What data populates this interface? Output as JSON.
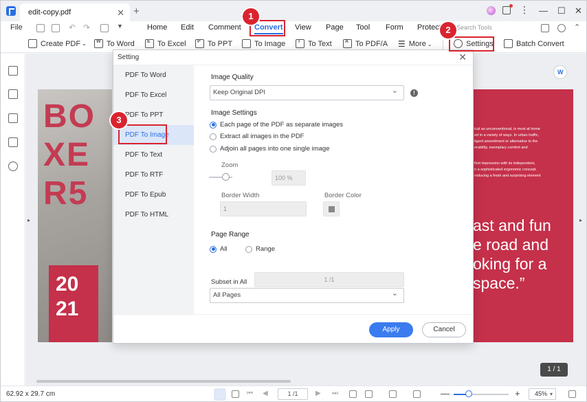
{
  "window": {
    "doc_tab": "edit-copy.pdf",
    "search_placeholder": "Search Tools"
  },
  "menu": {
    "file": "File",
    "items": [
      "Home",
      "Edit",
      "Comment",
      "Convert",
      "View",
      "Page",
      "Tool",
      "Form",
      "Protect"
    ],
    "active": "Convert"
  },
  "ribbon": {
    "create_pdf": "Create PDF",
    "to_word": "To Word",
    "to_excel": "To Excel",
    "to_ppt": "To PPT",
    "to_image": "To Image",
    "to_text": "To Text",
    "to_pdfa": "To PDF/A",
    "more": "More",
    "settings": "Settings",
    "batch_convert": "Batch Convert"
  },
  "document": {
    "left_title": "BOXER5",
    "left_lines": [
      "BO",
      "XE",
      "R5"
    ],
    "year_lines": [
      "20",
      "21"
    ],
    "right_small_1": [
      "ical as unconventional, is most at home",
      "ed in a variety of ways. In urban traffic,",
      "ligent amendment or alternative to the",
      "erability, exemplary comfort and"
    ],
    "right_small_2": [
      "first impression with its independent,",
      "n a sophisticated ergonomic concept.",
      "roducing a fresh and surprising element"
    ],
    "right_quote": [
      "ast and fun",
      "e road and",
      "oking for a",
      "space.”"
    ],
    "page_counter": "1 / 1"
  },
  "statusbar": {
    "dimensions": "62.92 x 29.7 cm",
    "page": "1 /1",
    "zoom": "45%",
    "zoom_level_pct": 45
  },
  "dialog": {
    "title": "Setting",
    "nav": [
      "PDF To Word",
      "PDF To Excel",
      "PDF To PPT",
      "PDF To Image",
      "PDF To Text",
      "PDF To RTF",
      "PDF To Epub",
      "PDF To HTML"
    ],
    "selected_nav": "PDF To Image",
    "image_quality_label": "Image Quality",
    "image_quality_value": "Keep Original DPI",
    "image_settings_label": "Image Settings",
    "image_options": [
      "Each page of the PDF as separate images",
      "Extract all images in the PDF",
      "Adjoin all pages into one single image"
    ],
    "image_option_selected": 0,
    "zoom_label": "Zoom",
    "zoom_value": "100 %",
    "border_width_label": "Border Width",
    "border_width_value": "1",
    "border_color_label": "Border Color",
    "border_color": "#888888",
    "page_range_label": "Page Range",
    "range_all": "All",
    "range_custom": "Range",
    "range_value": "1 /1",
    "subset_label": "Subset in All",
    "subset_value": "All Pages",
    "apply": "Apply",
    "cancel": "Cancel"
  },
  "annotations": {
    "step1": "1",
    "step2": "2",
    "step3": "3"
  },
  "colors": {
    "accent": "#2b6fe0",
    "callout": "#d9242f",
    "brochure": "#c5304a"
  }
}
